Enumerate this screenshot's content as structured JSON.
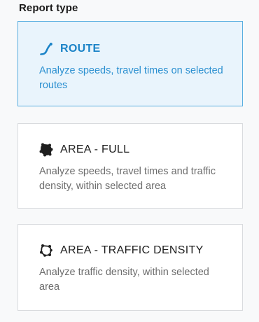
{
  "section_title": "Report type",
  "options": [
    {
      "title": "ROUTE",
      "description": "Analyze speeds, travel times on selected routes",
      "icon": "route-icon",
      "selected": true
    },
    {
      "title": "AREA - FULL",
      "description": "Analyze speeds, travel times and traffic density, within selected area",
      "icon": "area-full-icon",
      "selected": false
    },
    {
      "title": "AREA - TRAFFIC DENSITY",
      "description": "Analyze traffic density, within selected area",
      "icon": "area-density-icon",
      "selected": false
    }
  ],
  "colors": {
    "accent": "#1b83c7",
    "selected_bg": "#e9f4fc",
    "selected_border": "#5aaee0",
    "card_border": "#d9dbde",
    "text_muted": "#6d6d6d"
  }
}
